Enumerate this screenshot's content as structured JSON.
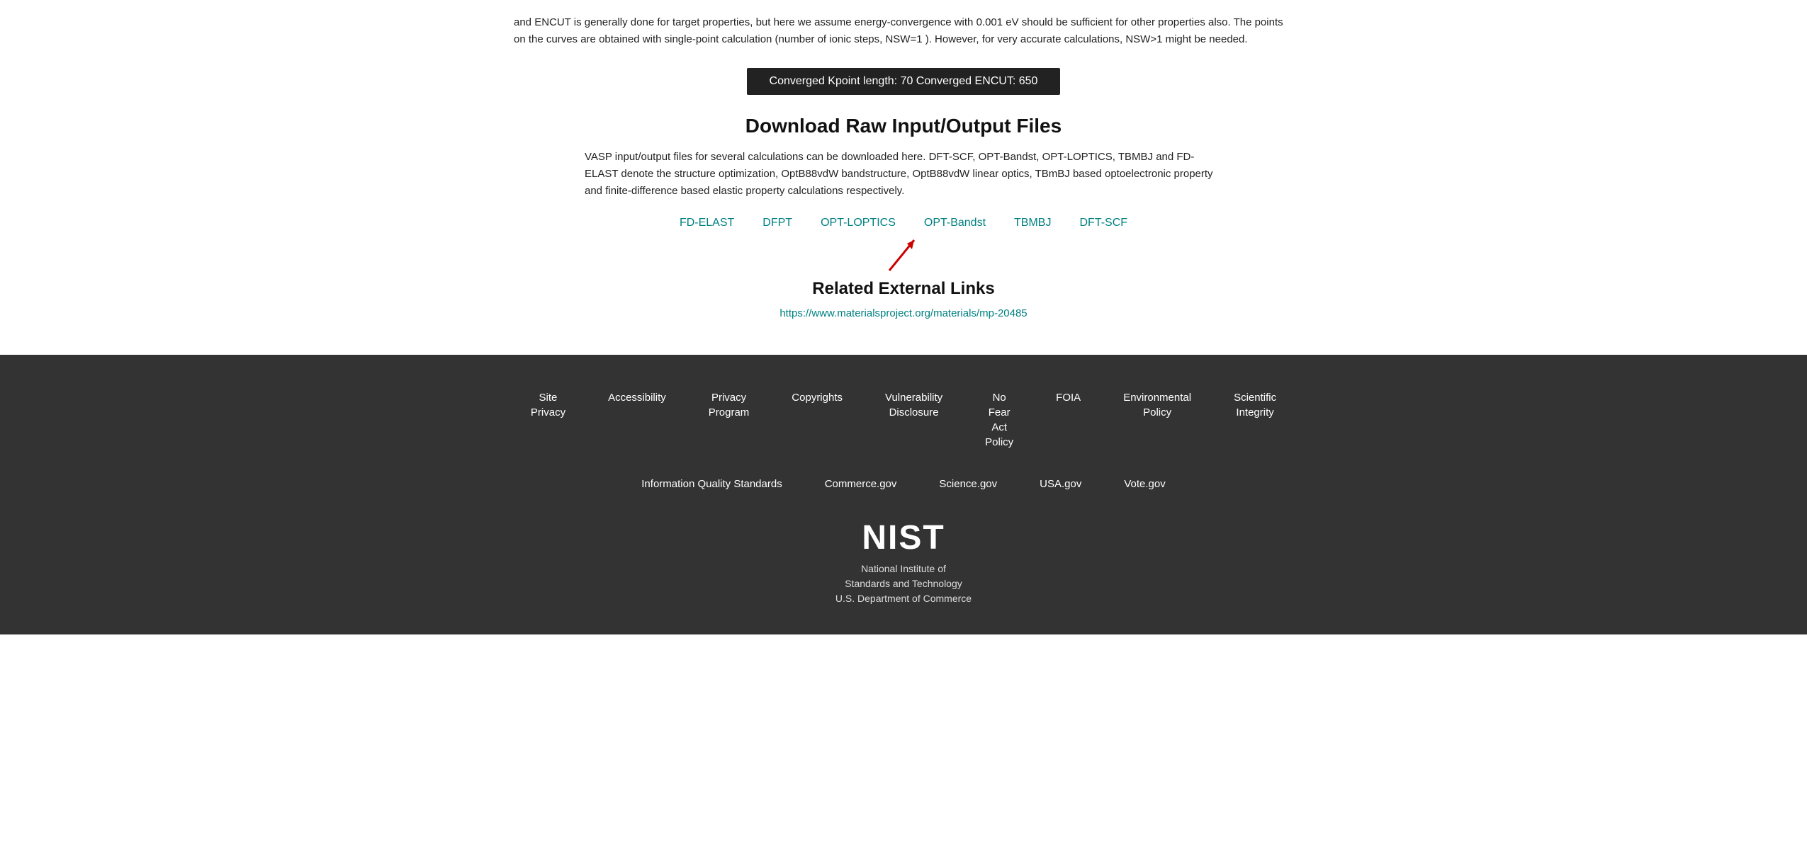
{
  "body": {
    "intro_text": "and ENCUT is generally done for target properties, but here we assume energy-convergence with 0.001 eV should be sufficient for other properties also. The points on the curves are obtained with single-point calculation (number of ionic steps, NSW=1 ). However, for very accurate calculations, NSW>1 might be needed.",
    "convergence_badge": "Converged Kpoint length: 70   Converged ENCUT: 650",
    "download_title": "Download Raw Input/Output Files",
    "download_desc": "VASP input/output files for several calculations can be downloaded here. DFT-SCF, OPT-Bandst, OPT-LOPTICS, TBMBJ and FD-ELAST denote the structure optimization, OptB88vdW bandstructure, OptB88vdW linear optics, TBmBJ based optoelectronic property and finite-difference based elastic property calculations respectively.",
    "download_links": [
      {
        "label": "FD-ELAST",
        "href": "#"
      },
      {
        "label": "DFPT",
        "href": "#"
      },
      {
        "label": "OPT-LOPTICS",
        "href": "#"
      },
      {
        "label": "OPT-Bandst",
        "href": "#"
      },
      {
        "label": "TBMBJ",
        "href": "#"
      },
      {
        "label": "DFT-SCF",
        "href": "#"
      }
    ],
    "related_title": "Related External Links",
    "related_link": "https://www.materialsproject.org/materials/mp-20485"
  },
  "footer": {
    "nav_row1": [
      {
        "label": "Site Privacy",
        "href": "#"
      },
      {
        "label": "Accessibility",
        "href": "#"
      },
      {
        "label": "Privacy Program",
        "href": "#"
      },
      {
        "label": "Copyrights",
        "href": "#"
      },
      {
        "label": "Vulnerability Disclosure",
        "href": "#"
      },
      {
        "label": "No Fear Act Policy",
        "href": "#"
      },
      {
        "label": "FOIA",
        "href": "#"
      },
      {
        "label": "Environmental Policy",
        "href": "#"
      },
      {
        "label": "Scientific Integrity",
        "href": "#"
      }
    ],
    "nav_row2": [
      {
        "label": "Information Quality Standards",
        "href": "#"
      },
      {
        "label": "Commerce.gov",
        "href": "#"
      },
      {
        "label": "Science.gov",
        "href": "#"
      },
      {
        "label": "USA.gov",
        "href": "#"
      },
      {
        "label": "Vote.gov",
        "href": "#"
      }
    ],
    "nist_name": "National Institute of",
    "nist_name2": "Standards and Technology",
    "nist_dept": "U.S. Department of Commerce"
  }
}
